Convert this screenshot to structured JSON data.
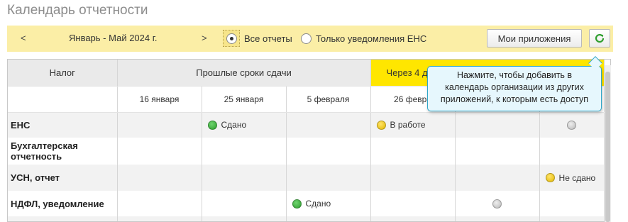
{
  "page": {
    "title": "Календарь отчетности"
  },
  "toolbar": {
    "prev": "<",
    "period": "Январь - Май 2024 г.",
    "next": ">",
    "radio_all": "Все отчеты",
    "radio_ens": "Только уведомления ЕНС",
    "selected": "radio_all",
    "apps_button": "Мои приложения",
    "refresh_icon": "refresh-icon"
  },
  "table": {
    "header_tax": "Налог",
    "header_past": "Прошлые сроки сдачи",
    "header_soon": "Через 4 д",
    "dates": [
      "16 января",
      "25 января",
      "5 февраля",
      "26 февра"
    ],
    "rows": [
      {
        "name": "ЕНС",
        "cells": [
          "",
          "Сдано",
          "",
          "В работе",
          "",
          ""
        ]
      },
      {
        "name": "Бухгалтерская отчетность",
        "cells": [
          "",
          "",
          "",
          "",
          "",
          ""
        ]
      },
      {
        "name": "УСН, отчет",
        "cells": [
          "",
          "",
          "",
          "",
          "",
          "Не сдано"
        ]
      },
      {
        "name": "НДФЛ, уведомление",
        "cells": [
          "",
          "",
          "Сдано",
          "",
          "",
          ""
        ]
      }
    ]
  },
  "tooltip": {
    "line1": "Нажмите, чтобы добавить в",
    "line2": "календарь организации из других",
    "line3": "приложений, к которым есть доступ"
  },
  "colors": {
    "toolbar_bg": "#fbeea6",
    "soon_header": "#ffe600",
    "status_done": "#2e9e2e",
    "status_in_work": "#e3b900",
    "status_pending": "#b8b8b8",
    "tooltip_border": "#2fa7c9"
  }
}
